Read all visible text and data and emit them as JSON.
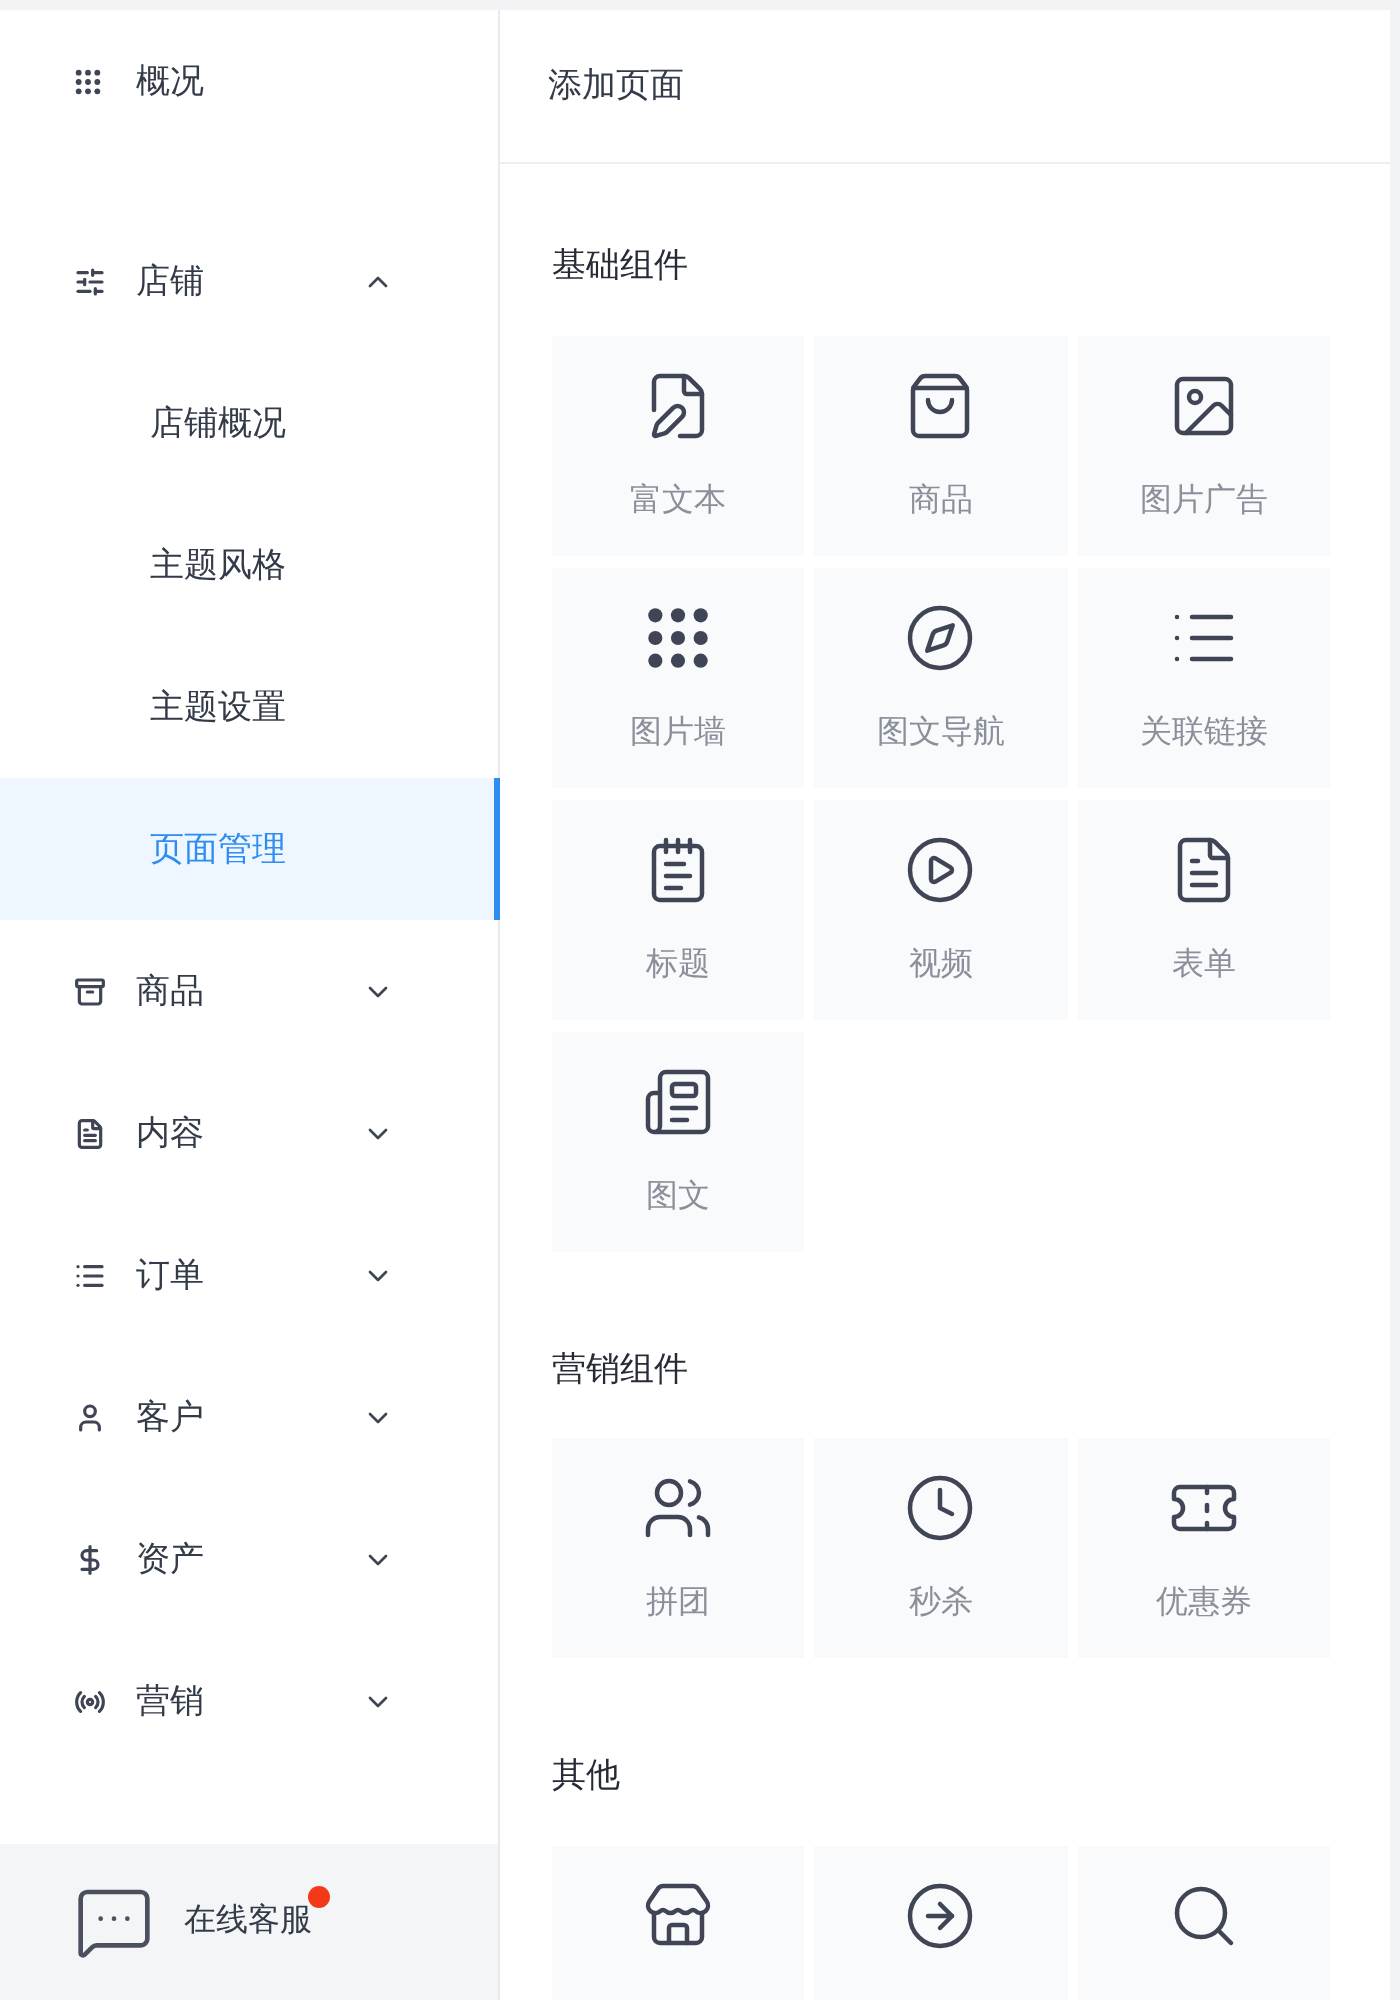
{
  "sidebar": {
    "items": [
      {
        "kind": "link",
        "label": "概况"
      },
      {
        "kind": "group",
        "label": "店铺",
        "expanded": true,
        "children": [
          {
            "label": "店铺概况",
            "selected": false
          },
          {
            "label": "主题风格",
            "selected": false
          },
          {
            "label": "主题设置",
            "selected": false
          },
          {
            "label": "页面管理",
            "selected": true
          }
        ]
      },
      {
        "kind": "group",
        "label": "商品",
        "expanded": false
      },
      {
        "kind": "group",
        "label": "内容",
        "expanded": false
      },
      {
        "kind": "group",
        "label": "订单",
        "expanded": false
      },
      {
        "kind": "group",
        "label": "客户",
        "expanded": false
      },
      {
        "kind": "group",
        "label": "资产",
        "expanded": false
      },
      {
        "kind": "group",
        "label": "营销",
        "expanded": false
      }
    ],
    "support": {
      "label": "在线客服",
      "badge": true
    }
  },
  "panel": {
    "title": "添加页面",
    "sections": [
      {
        "title": "基础组件",
        "items": [
          {
            "kind": "tile",
            "label": "富文本"
          },
          {
            "kind": "tile",
            "label": "商品"
          },
          {
            "kind": "tile",
            "label": "图片广告"
          },
          {
            "kind": "tile",
            "label": "图片墙"
          },
          {
            "kind": "tile",
            "label": "图文导航"
          },
          {
            "kind": "tile",
            "label": "关联链接"
          },
          {
            "kind": "tile",
            "label": "标题"
          },
          {
            "kind": "tile",
            "label": "视频"
          },
          {
            "kind": "tile",
            "label": "表单"
          },
          {
            "kind": "tile",
            "label": "图文"
          }
        ]
      },
      {
        "title": "营销组件",
        "items": [
          {
            "kind": "tile",
            "label": "拼团"
          },
          {
            "kind": "tile",
            "label": "秒杀"
          },
          {
            "kind": "tile",
            "label": "优惠券"
          }
        ]
      },
      {
        "title": "其他",
        "items": [
          {
            "kind": "tile"
          },
          {
            "kind": "tile"
          },
          {
            "kind": "tile"
          }
        ]
      }
    ]
  }
}
